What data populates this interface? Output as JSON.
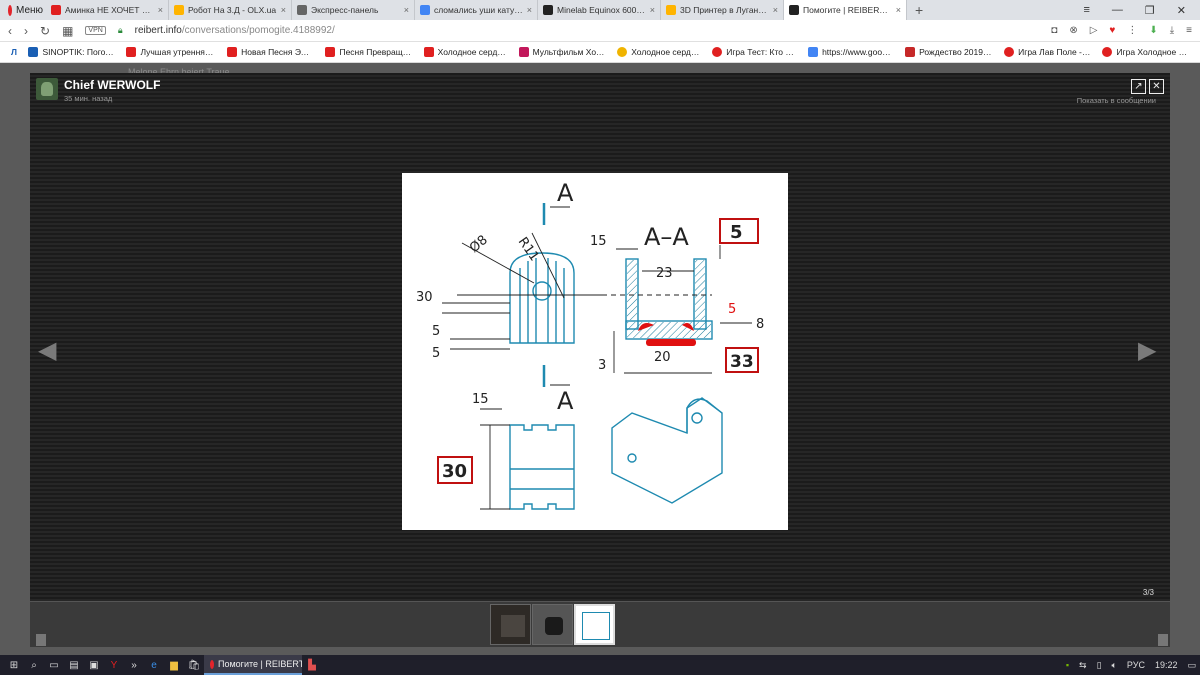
{
  "browser": {
    "menu_label": "Меню",
    "tabs": [
      {
        "title": "Аминка НЕ ХОЧЕТ Быть М",
        "color": "#e02020"
      },
      {
        "title": "Робот На 3.Д - OLX.ua",
        "color": "#ffb400"
      },
      {
        "title": "Экспресс-панель",
        "color": "#666666"
      },
      {
        "title": "сломались уши катушки",
        "color": "#4285f4"
      },
      {
        "title": "Minelab Equinox 600/800 |",
        "color": "#222222"
      },
      {
        "title": "3D Принтер в Луганская",
        "color": "#ffb400"
      },
      {
        "title": "Помогите | REIBERT.info",
        "color": "#222222"
      }
    ],
    "url_host": "reibert.info",
    "url_path": "/conversations/pomogite.4188992/",
    "vpn_label": "VPN",
    "bookmarks": [
      {
        "title": "SINOPTIK: Погода...",
        "color": "#1a5fb4"
      },
      {
        "title": "Лучшая утренняя з...",
        "color": "#e02020"
      },
      {
        "title": "Новая Песня Эльз...",
        "color": "#e02020"
      },
      {
        "title": "Песня Превращен...",
        "color": "#e02020"
      },
      {
        "title": "Холодное сердце...",
        "color": "#e02020"
      },
      {
        "title": "Мультфильм Холо...",
        "color": "#c2185b"
      },
      {
        "title": "Холодное сердце...",
        "color": "#f0b400"
      },
      {
        "title": "Игра Тест: Кто Ты...",
        "color": "#e02020"
      },
      {
        "title": "https://www.google...",
        "color": "#4285f4"
      },
      {
        "title": "Рождество 2019: л...",
        "color": "#c62828"
      },
      {
        "title": "Игра Лав Поле - О...",
        "color": "#e02020"
      },
      {
        "title": "Игра Холодное Се...",
        "color": "#e02020"
      }
    ]
  },
  "page": {
    "background_hint": "Melone Ehrn beiert Traue"
  },
  "lightbox": {
    "username": "Chief WERWOLF",
    "time": "35 мин. назад",
    "show_in_message": "Показать в сообщении",
    "counter": "3/3"
  },
  "drawing": {
    "section_mark": "A",
    "section_title": "A–A",
    "dims": {
      "d1": "15",
      "d2": "23",
      "d3": "8",
      "d4": "20",
      "d5": "3",
      "r1": "R11",
      "dia": "Ø8",
      "h30": "30",
      "v5a": "5",
      "v5b": "5",
      "top15": "15",
      "weld": "5"
    },
    "boxed": [
      "5",
      "33",
      "30"
    ]
  },
  "taskbar": {
    "active_task": "Помогите | REIBERT.i...",
    "lang": "РУС",
    "time": "19:22"
  }
}
